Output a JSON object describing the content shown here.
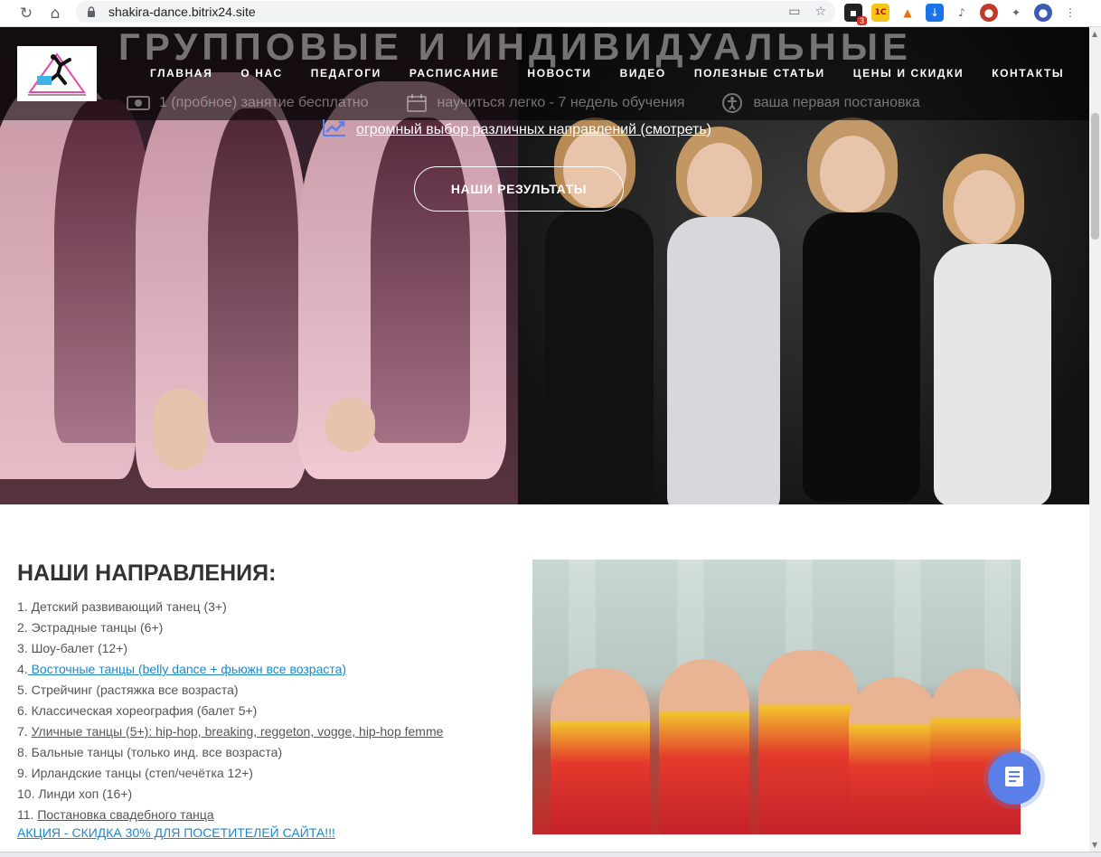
{
  "browser": {
    "url": "shakira-dance.bitrix24.site",
    "extensions_badge": "3"
  },
  "hero": {
    "title": "ГРУППОВЫЕ И ИНДИВИДУАЛЬНЫЕ",
    "nav": [
      "ГЛАВНАЯ",
      "О НАС",
      "ПЕДАГОГИ",
      "РАСПИСАНИЕ",
      "НОВОСТИ",
      "ВИДЕО",
      "ПОЛЕЗНЫЕ СТАТЬИ",
      "ЦЕНЫ И СКИДКИ",
      "КОНТАКТЫ"
    ],
    "features": [
      {
        "icon": "money-icon",
        "text": "1 (пробное) занятие бесплатно"
      },
      {
        "icon": "calendar-icon",
        "text": "научиться легко - 7 недель обучения"
      },
      {
        "icon": "accessibility-icon",
        "text": "ваша первая постановка"
      }
    ],
    "feature_link": {
      "icon": "trending-up-icon",
      "text": "огромный выбор различных направлений (смотреть)"
    },
    "results_button": "НАШИ РЕЗУЛЬТАТЫ",
    "accent": "#5b7fe8"
  },
  "directions": {
    "title": "НАШИ НАПРАВЛЕНИЯ:",
    "items": [
      {
        "prefix": "1. ",
        "text": "Детский развивающий танец (3+)",
        "link": ""
      },
      {
        "prefix": "2. ",
        "text": "Эстрадные танцы (6+)",
        "link": ""
      },
      {
        "prefix": "3. ",
        "text": "Шоу-балет (12+)",
        "link": ""
      },
      {
        "prefix": "4.",
        "text": "",
        "link": " Восточные танцы (belly dance + фьюжн все возраста)",
        "link_style": "blue"
      },
      {
        "prefix": "5. ",
        "text": "Стрейчинг (растяжка все возраста)",
        "link": ""
      },
      {
        "prefix": "6. ",
        "text": "Классическая хореография (балет 5+)",
        "link": ""
      },
      {
        "prefix": "7. ",
        "text": "",
        "link": "Уличные танцы (5+): hip-hop, breaking, reggeton, vogge, hip-hop femme",
        "link_style": "gray"
      },
      {
        "prefix": "8. ",
        "text": "Бальные танцы (только инд. все возраста)",
        "link": ""
      },
      {
        "prefix": "9. ",
        "text": "Ирландские танцы (степ/чечётка 12+)",
        "link": ""
      },
      {
        "prefix": "10. ",
        "text": "Линди хоп (16+)",
        "link": ""
      },
      {
        "prefix": "11. ",
        "text": "",
        "link": "Постановка свадебного танца",
        "link_style": "gray"
      }
    ],
    "promo": "АКЦИЯ - СКИДКА 30% ДЛЯ ПОСЕТИТЕЛЕЙ САЙТА!!!"
  }
}
